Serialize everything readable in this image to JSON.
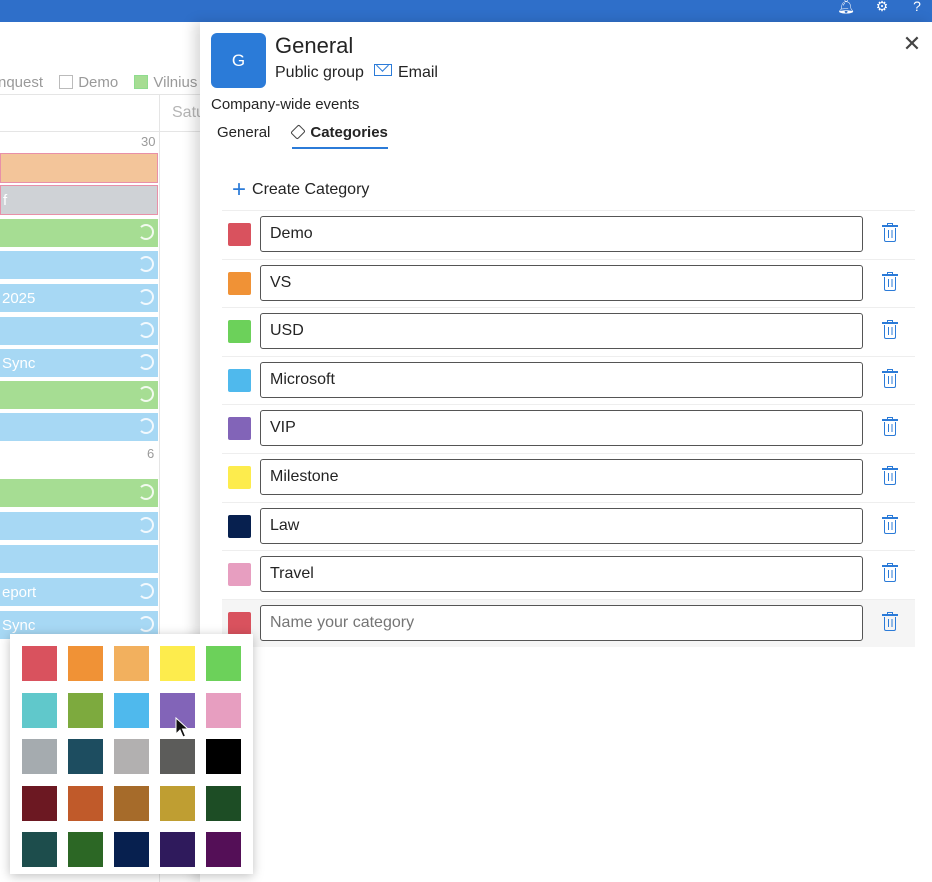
{
  "topbar": {
    "icons": [
      "bell-icon",
      "gear-icon",
      "help-icon"
    ]
  },
  "calendar": {
    "filters": [
      {
        "label": "nquest"
      },
      {
        "label": "Demo"
      },
      {
        "label": "Vilnius"
      }
    ],
    "day_header": "Satu",
    "day_numbers": [
      "30",
      "6"
    ],
    "events": [
      {
        "label": "",
        "color": "orange"
      },
      {
        "label": "f",
        "color": "grey"
      },
      {
        "label": "",
        "color": "green",
        "sync": true
      },
      {
        "label": "",
        "color": "blue",
        "sync": true
      },
      {
        "label": " 2025",
        "color": "blue",
        "sync": true
      },
      {
        "label": "",
        "color": "blue",
        "sync": true
      },
      {
        "label": "Sync",
        "color": "blue",
        "sync": true
      },
      {
        "label": "",
        "color": "green",
        "sync": true
      },
      {
        "label": "",
        "color": "blue",
        "sync": true
      },
      {
        "label": "",
        "color": "green",
        "sync": true
      },
      {
        "label": "",
        "color": "blue",
        "sync": true
      },
      {
        "label": "",
        "color": "blue",
        "sync": false
      },
      {
        "label": "eport",
        "color": "blue",
        "sync": true
      },
      {
        "label": "Sync",
        "color": "blue",
        "sync": true
      }
    ]
  },
  "panel": {
    "avatar_letter": "G",
    "title": "General",
    "group_type": "Public group",
    "email_label": "Email",
    "description": "Company-wide events",
    "tabs": [
      {
        "label": "General",
        "active": false
      },
      {
        "label": "Categories",
        "active": true
      }
    ],
    "create_label": "Create Category",
    "categories": [
      {
        "name": "Demo",
        "color": "#d9525e"
      },
      {
        "name": "VS",
        "color": "#f09236"
      },
      {
        "name": "USD",
        "color": "#6cd15a"
      },
      {
        "name": "Microsoft",
        "color": "#4fb9ed"
      },
      {
        "name": "VIP",
        "color": "#8264b8"
      },
      {
        "name": "Milestone",
        "color": "#fdec4d"
      },
      {
        "name": "Law",
        "color": "#07204f"
      },
      {
        "name": "Travel",
        "color": "#e79ec0"
      }
    ],
    "new_category": {
      "placeholder": "Name your category",
      "color": "#d9525e"
    }
  },
  "color_picker": {
    "colors": [
      [
        "#d9525e",
        "#f09236",
        "#f2b05e",
        "#fdec4d",
        "#6cd15a"
      ],
      [
        "#60c8cb",
        "#7daa3e",
        "#4fb9ed",
        "#8264b8",
        "#e79ec0"
      ],
      [
        "#a5abaf",
        "#1d4d60",
        "#b2b0b0",
        "#5c5c5a",
        "#000000"
      ],
      [
        "#6c1822",
        "#c05a2a",
        "#a66b2a",
        "#bf9e32",
        "#1d4d25"
      ],
      [
        "#1d4d4c",
        "#2c6725",
        "#07204f",
        "#2f1a5c",
        "#540f57"
      ]
    ]
  }
}
